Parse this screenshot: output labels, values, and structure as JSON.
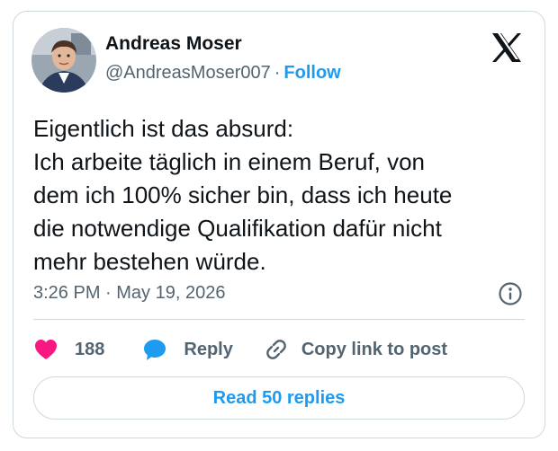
{
  "author": {
    "name": "Andreas Moser",
    "handle": "@AndreasMoser007",
    "separator": "·",
    "follow_label": "Follow"
  },
  "tweet": {
    "lines": [
      "Eigentlich ist das absurd:",
      "Ich arbeite täglich in einem Beruf, von",
      "dem ich 100% sicher bin, dass ich heute",
      "die notwendige Qualifikation dafür nicht",
      "mehr bestehen würde."
    ],
    "timestamp": "3:26 PM · May 19, 2026"
  },
  "actions": {
    "like_count": "188",
    "reply_label": "Reply",
    "copy_link_label": "Copy link to post"
  },
  "footer": {
    "read_replies_label": "Read 50 replies"
  },
  "icons": {
    "brand": "x-logo-icon",
    "info": "info-icon",
    "like": "heart-icon",
    "reply": "speech-bubble-icon",
    "copy": "link-icon"
  },
  "colors": {
    "accent": "#1d9bf0",
    "like": "#f91880",
    "text": "#0f1419",
    "muted": "#536471",
    "border": "#cfd9de"
  }
}
